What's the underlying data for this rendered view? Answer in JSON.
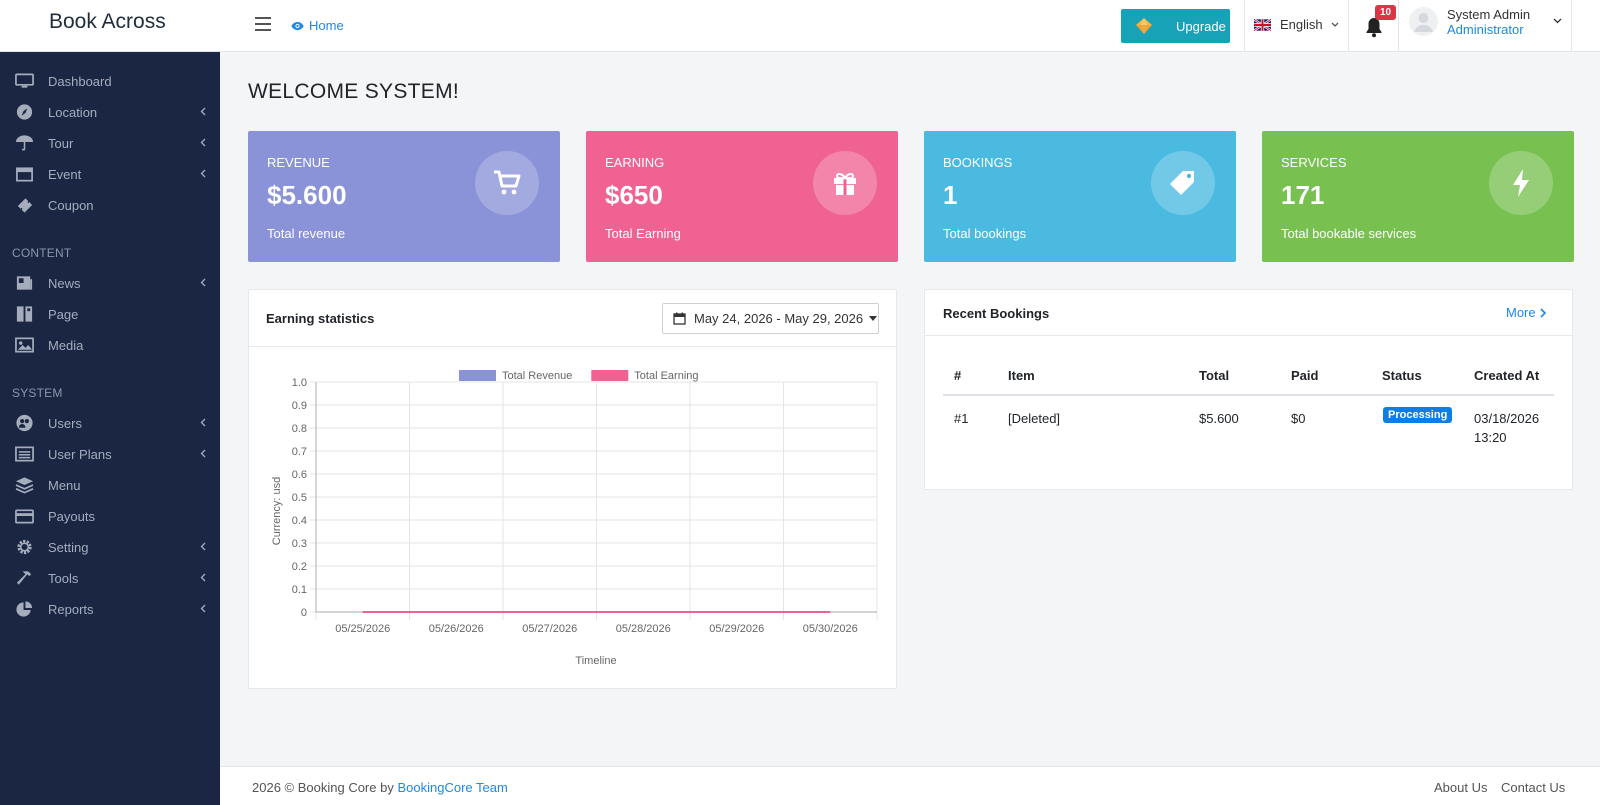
{
  "header": {
    "brand": "Book Across",
    "home_label": "Home",
    "upgrade_label": "Upgrade",
    "language": "English",
    "notification_count": "10",
    "user_name": "System Admin",
    "user_role": "Administrator"
  },
  "sidebar": {
    "items": [
      {
        "label": "Dashboard",
        "icon": "monitor-icon",
        "has_children": false
      },
      {
        "label": "Location",
        "icon": "compass-icon",
        "has_children": true
      },
      {
        "label": "Tour",
        "icon": "umbrella-icon",
        "has_children": true
      },
      {
        "label": "Event",
        "icon": "calendar-icon",
        "has_children": true
      },
      {
        "label": "Coupon",
        "icon": "ticket-icon",
        "has_children": false
      }
    ],
    "content_section": "CONTENT",
    "content_items": [
      {
        "label": "News",
        "icon": "newspaper-icon",
        "has_children": true
      },
      {
        "label": "Page",
        "icon": "book-icon",
        "has_children": false
      },
      {
        "label": "Media",
        "icon": "image-icon",
        "has_children": false
      }
    ],
    "system_section": "SYSTEM",
    "system_items": [
      {
        "label": "Users",
        "icon": "users-icon",
        "has_children": true
      },
      {
        "label": "User Plans",
        "icon": "list-icon",
        "has_children": true
      },
      {
        "label": "Menu",
        "icon": "layers-icon",
        "has_children": false
      },
      {
        "label": "Payouts",
        "icon": "credit-card-icon",
        "has_children": false
      },
      {
        "label": "Setting",
        "icon": "gear-icon",
        "has_children": true
      },
      {
        "label": "Tools",
        "icon": "hammer-icon",
        "has_children": true
      },
      {
        "label": "Reports",
        "icon": "pie-chart-icon",
        "has_children": true
      }
    ]
  },
  "main": {
    "welcome": "WELCOME SYSTEM!",
    "cards": [
      {
        "title": "REVENUE",
        "value": "$5.600",
        "desc": "Total revenue",
        "color": "#8a93d8",
        "icon": "cart-icon"
      },
      {
        "title": "EARNING",
        "value": "$650",
        "desc": "Total Earning",
        "color": "#f06292",
        "icon": "gift-icon"
      },
      {
        "title": "BOOKINGS",
        "value": "1",
        "desc": "Total bookings",
        "color": "#4bbae0",
        "icon": "tag-icon"
      },
      {
        "title": "SERVICES",
        "value": "171",
        "desc": "Total bookable services",
        "color": "#78c151",
        "icon": "bolt-icon"
      }
    ],
    "earning_panel": {
      "title": "Earning statistics",
      "date_range": "May 24, 2026 - May 29, 2026"
    },
    "recent_bookings": {
      "title": "Recent Bookings",
      "more_label": "More",
      "columns": [
        "#",
        "Item",
        "Total",
        "Paid",
        "Status",
        "Created At"
      ],
      "rows": [
        {
          "id": "#1",
          "item": "[Deleted]",
          "total": "$5.600",
          "paid": "$0",
          "status": "Processing",
          "created_date": "03/18/2026",
          "created_time": "13:20"
        }
      ]
    }
  },
  "chart_data": {
    "type": "line",
    "x": [
      "05/25/2026",
      "05/26/2026",
      "05/27/2026",
      "05/28/2026",
      "05/29/2026",
      "05/30/2026"
    ],
    "series": [
      {
        "name": "Total Revenue",
        "values": [
          0,
          0,
          0,
          0,
          0,
          0
        ],
        "color": "#8a93d8"
      },
      {
        "name": "Total Earning",
        "values": [
          0,
          0,
          0,
          0,
          0,
          0
        ],
        "color": "#f06292"
      }
    ],
    "xlabel": "Timeline",
    "ylabel": "Currency: usd",
    "ylim": [
      0,
      1
    ],
    "yticks": [
      "0",
      "0.1",
      "0.2",
      "0.3",
      "0.4",
      "0.5",
      "0.6",
      "0.7",
      "0.8",
      "0.9",
      "1.0"
    ],
    "grid": true,
    "legend": "top"
  },
  "footer": {
    "copyright": "2026 © Booking Core by",
    "team_link": "BookingCore Team",
    "about": "About Us",
    "contact": "Contact Us"
  }
}
